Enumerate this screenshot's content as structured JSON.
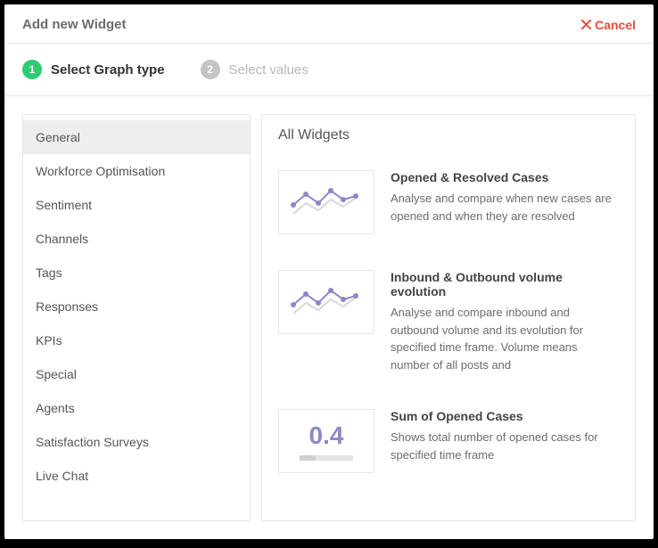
{
  "header": {
    "title": "Add new Widget",
    "cancel": "Cancel"
  },
  "steps": [
    {
      "num": "1",
      "label": "Select Graph type",
      "state": "active"
    },
    {
      "num": "2",
      "label": "Select values",
      "state": "inactive"
    }
  ],
  "sidebar": {
    "items": [
      {
        "label": "General",
        "selected": true
      },
      {
        "label": "Workforce Optimisation",
        "selected": false
      },
      {
        "label": "Sentiment",
        "selected": false
      },
      {
        "label": "Channels",
        "selected": false
      },
      {
        "label": "Tags",
        "selected": false
      },
      {
        "label": "Responses",
        "selected": false
      },
      {
        "label": "KPIs",
        "selected": false
      },
      {
        "label": "Special",
        "selected": false
      },
      {
        "label": "Agents",
        "selected": false
      },
      {
        "label": "Satisfaction Surveys",
        "selected": false
      },
      {
        "label": "Live Chat",
        "selected": false
      }
    ]
  },
  "main": {
    "title": "All Widgets",
    "widgets": [
      {
        "icon": "line-chart",
        "title": "Opened & Resolved Cases",
        "desc": "Analyse and compare when new cases are opened and when they are resolved"
      },
      {
        "icon": "line-chart",
        "title": "Inbound & Outbound volume evolution",
        "desc": "Analyse and compare inbound and outbound volume and its evolution for specified time frame. Volume means number of all posts and"
      },
      {
        "icon": "kpi-number",
        "kpi_value": "0.4",
        "title": "Sum of Opened Cases",
        "desc": "Shows total number of opened cases for specified time frame"
      }
    ]
  },
  "colors": {
    "accent_green": "#2ecc71",
    "accent_red": "#e74c3c",
    "chart_purple": "#8b88c9"
  }
}
